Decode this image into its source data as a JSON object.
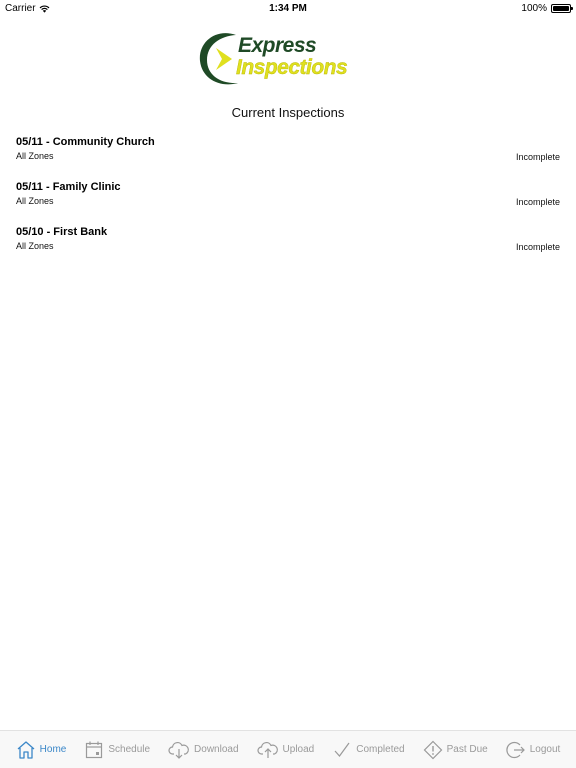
{
  "status_bar": {
    "carrier": "Carrier",
    "time": "1:34 PM",
    "battery": "100%",
    "battery_level": 1.0
  },
  "header": {
    "logo_word1": "Express",
    "logo_word2": "Inspections",
    "page_title": "Current Inspections"
  },
  "inspections": [
    {
      "title": "05/11 - Community Church",
      "zones": "All Zones",
      "status": "Incomplete"
    },
    {
      "title": "05/11 - Family Clinic",
      "zones": "All Zones",
      "status": "Incomplete"
    },
    {
      "title": "05/10 - First Bank",
      "zones": "All Zones",
      "status": "Incomplete"
    }
  ],
  "tabs": [
    {
      "label": "Home",
      "icon": "home-icon",
      "active": true
    },
    {
      "label": "Schedule",
      "icon": "calendar-icon",
      "active": false
    },
    {
      "label": "Download",
      "icon": "cloud-download-icon",
      "active": false
    },
    {
      "label": "Upload",
      "icon": "cloud-upload-icon",
      "active": false
    },
    {
      "label": "Completed",
      "icon": "checkmark-icon",
      "active": false
    },
    {
      "label": "Past Due",
      "icon": "alert-diamond-icon",
      "active": false
    },
    {
      "label": "Logout",
      "icon": "logout-icon",
      "active": false
    }
  ],
  "colors": {
    "active_tab": "#3b87c8",
    "inactive_tab": "#9a9a9a",
    "logo_green": "#1f4a26",
    "logo_yellow": "#e0e01f"
  }
}
